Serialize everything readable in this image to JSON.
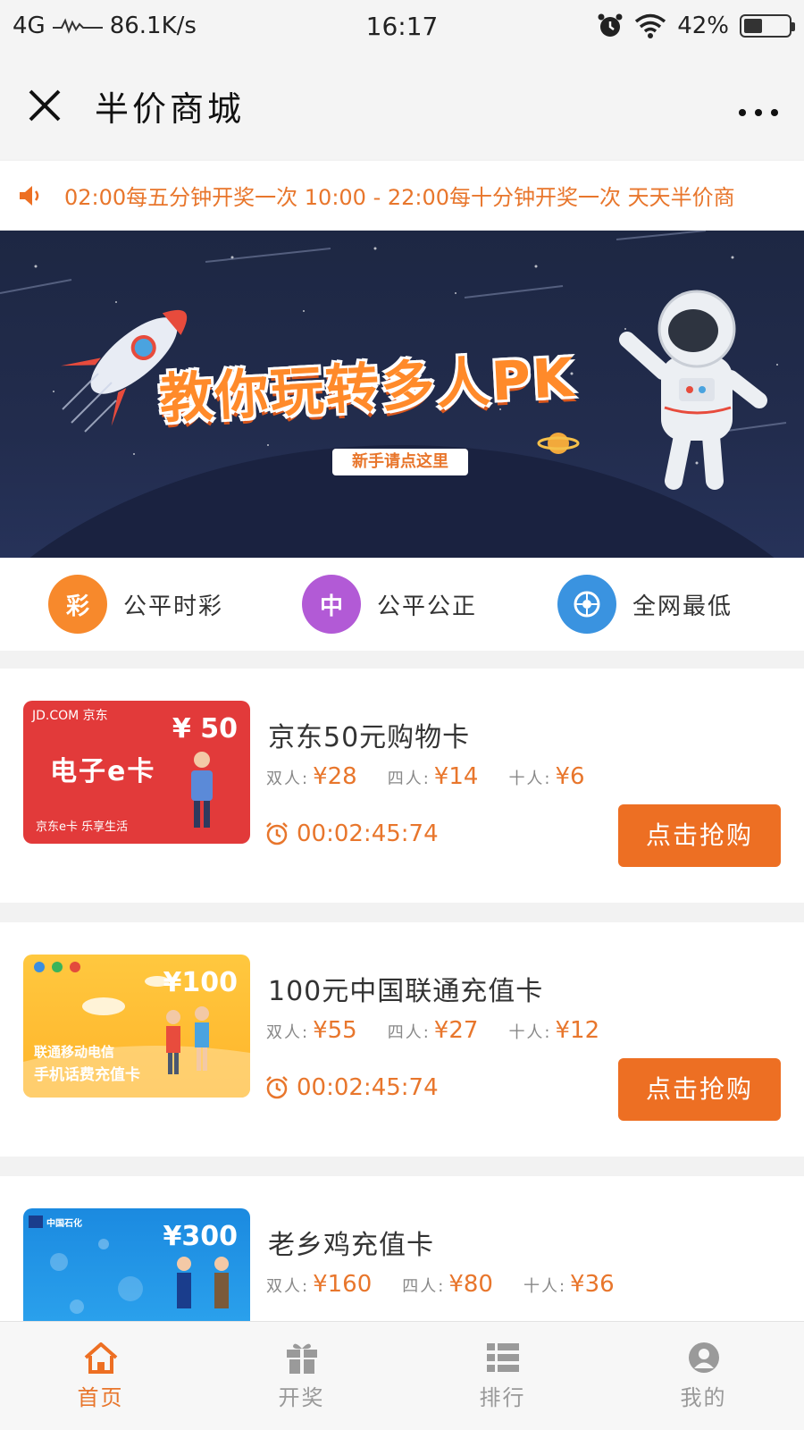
{
  "status_bar": {
    "network": "4G",
    "speed": "86.1K/s",
    "time": "16:17",
    "battery": "42%",
    "battery_level": 0.42
  },
  "nav": {
    "title": "半价商城",
    "more": "···"
  },
  "notice": {
    "text": "02:00每五分钟开奖一次 10:00 - 22:00每十分钟开奖一次 天天半价商"
  },
  "banner": {
    "title": "教你玩转多人PK",
    "button": "新手请点这里"
  },
  "features": [
    {
      "icon_char": "彩",
      "label": "公平时彩",
      "color": "#f7892c",
      "icon": "lottery-icon"
    },
    {
      "icon_char": "中",
      "label": "公平公正",
      "color": "#b25ad6",
      "icon": "fair-icon"
    },
    {
      "icon_char": "",
      "label": "全网最低",
      "color": "#3a93e0",
      "icon": "lowest-price-icon"
    }
  ],
  "products": [
    {
      "name": "京东50元购物卡",
      "thumb_amount": "¥ 50",
      "thumb_brand": "JD.COM 京东",
      "thumb_main": "电子e卡",
      "thumb_sub": "京东e卡 乐享生活",
      "prices": [
        {
          "label": "双人:",
          "value": "¥28"
        },
        {
          "label": "四人:",
          "value": "¥14"
        },
        {
          "label": "十人:",
          "value": "¥6"
        }
      ],
      "timer": "00:02:45:74",
      "button": "点击抢购"
    },
    {
      "name": "100元中国联通充值卡",
      "thumb_amount": "¥100",
      "thumb_main": "联通移动电信",
      "thumb_sub": "手机话费充值卡",
      "prices": [
        {
          "label": "双人:",
          "value": "¥55"
        },
        {
          "label": "四人:",
          "value": "¥27"
        },
        {
          "label": "十人:",
          "value": "¥12"
        }
      ],
      "timer": "00:02:45:74",
      "button": "点击抢购"
    },
    {
      "name": "老乡鸡充值卡",
      "thumb_amount": "¥300",
      "thumb_brand": "中国石化",
      "prices": [
        {
          "label": "双人:",
          "value": "¥160"
        },
        {
          "label": "四人:",
          "value": "¥80"
        },
        {
          "label": "十人:",
          "value": "¥36"
        }
      ]
    }
  ],
  "tabs": [
    {
      "label": "首页",
      "icon": "home-icon",
      "active": true
    },
    {
      "label": "开奖",
      "icon": "gift-icon",
      "active": false
    },
    {
      "label": "排行",
      "icon": "ranking-icon",
      "active": false
    },
    {
      "label": "我的",
      "icon": "profile-icon",
      "active": false
    }
  ],
  "colors": {
    "accent": "#ed6f23",
    "price": "#e8762c"
  }
}
